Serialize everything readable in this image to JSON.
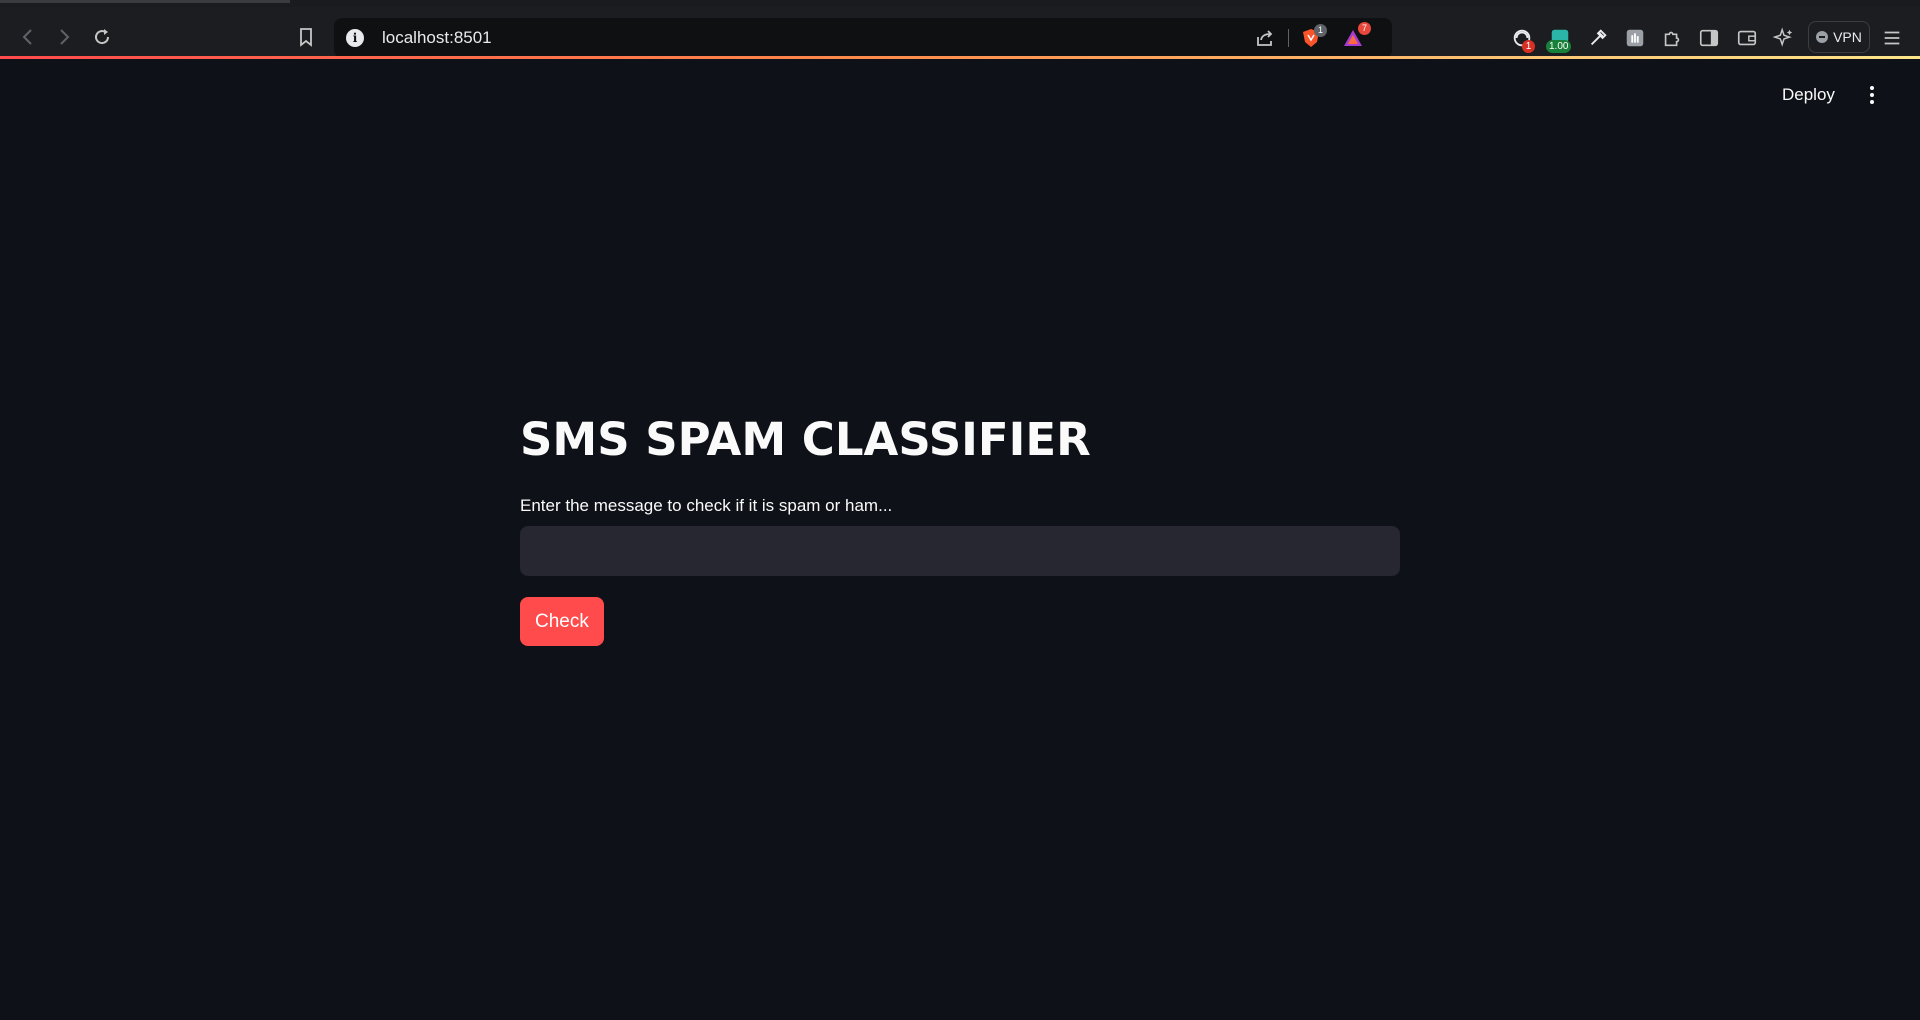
{
  "browser": {
    "url": "localhost:8501",
    "info_icon_glyph": "i",
    "brave_shields_count": "1",
    "brave_rewards_count": "7",
    "ext_badge_1": "1",
    "ext_badge_2": "1.00",
    "vpn_label": "VPN",
    "icons": [
      "back-arrow-icon",
      "forward-arrow-icon",
      "reload-icon",
      "bookmark-icon",
      "site-info-icon",
      "share-icon",
      "brave-shields-icon",
      "brave-rewards-icon",
      "extension-icon",
      "extension-meter-icon",
      "eyedropper-icon",
      "extension-hand-icon",
      "puzzle-extensions-icon",
      "sidebar-icon",
      "wallet-icon",
      "leo-ai-icon",
      "menu-icon"
    ]
  },
  "header": {
    "deploy_label": "Deploy",
    "menu_icon": "kebab-menu-icon"
  },
  "main": {
    "title": "SMS SPAM CLASSIFIER",
    "input_label": "Enter the message to check if it is spam or ham...",
    "input_value": "",
    "check_button": "Check"
  },
  "colors": {
    "background": "#0e1117",
    "input_bg": "#262730",
    "primary": "#ff4b4b",
    "text": "#fafafa"
  }
}
